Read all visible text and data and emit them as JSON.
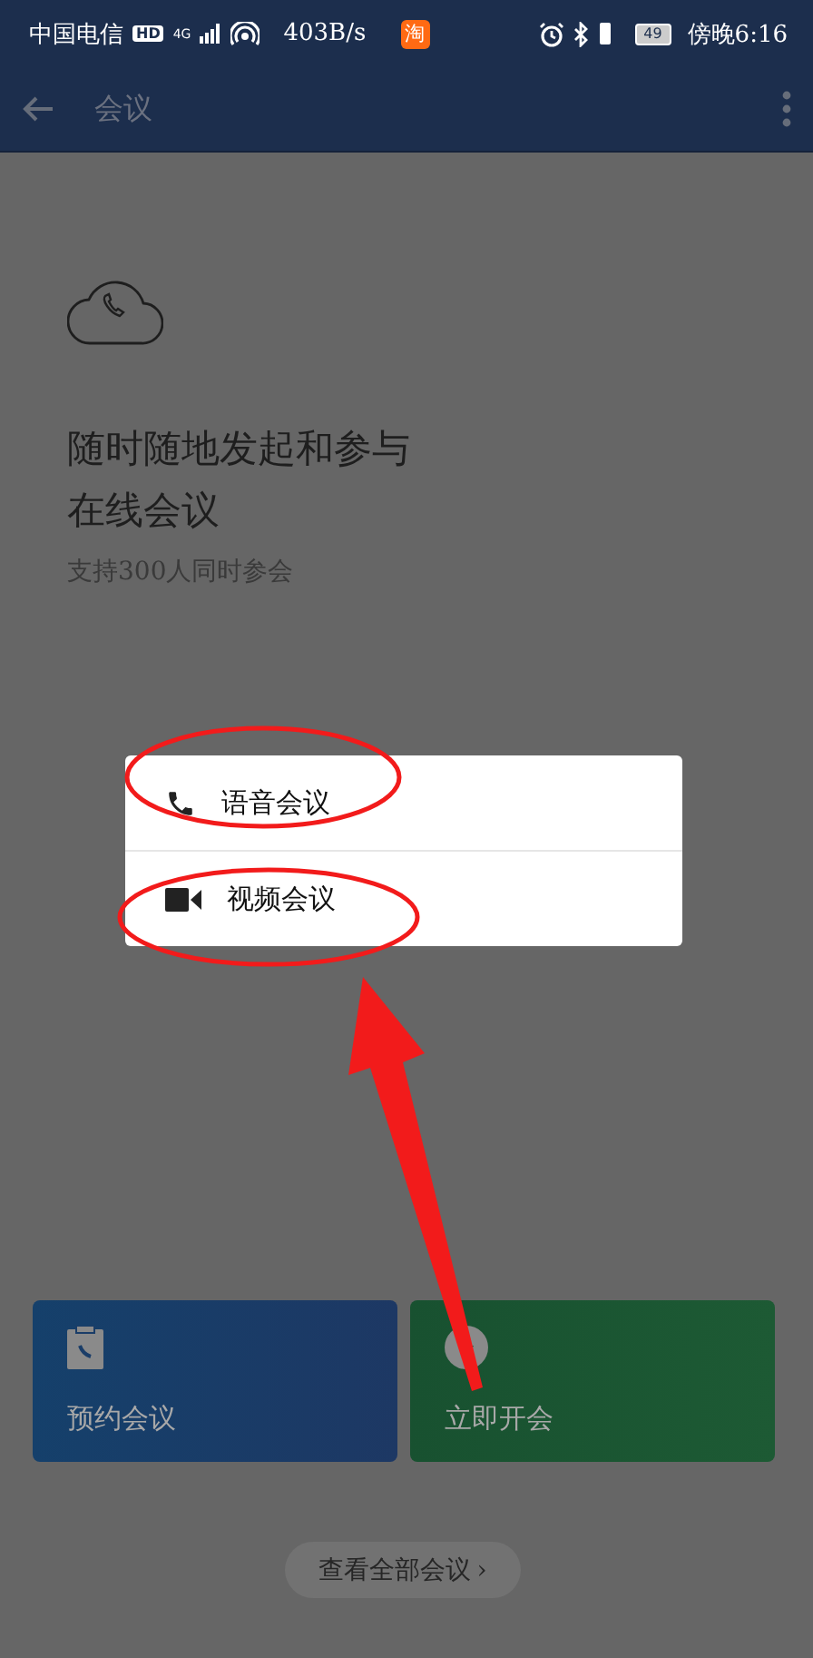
{
  "status_bar": {
    "carrier": "中国电信",
    "hd": "HD",
    "network": "4G",
    "speed": "403B/s",
    "notification": "淘",
    "battery": "49",
    "time": "傍晚6:16"
  },
  "app_bar": {
    "title": "会议"
  },
  "intro": {
    "headline_lines": [
      "随时随地发起和参与",
      "在线会议"
    ],
    "subtitle": "支持300人同时参会"
  },
  "popup_menu": [
    {
      "kind": "voice",
      "label": "语音会议"
    },
    {
      "kind": "video",
      "label": "视频会议"
    }
  ],
  "cards": [
    {
      "kind": "schedule",
      "label": "预约会议"
    },
    {
      "kind": "instant",
      "label": "立即开会"
    }
  ],
  "view_all": {
    "label": "查看全部会议",
    "chevron": "›"
  }
}
